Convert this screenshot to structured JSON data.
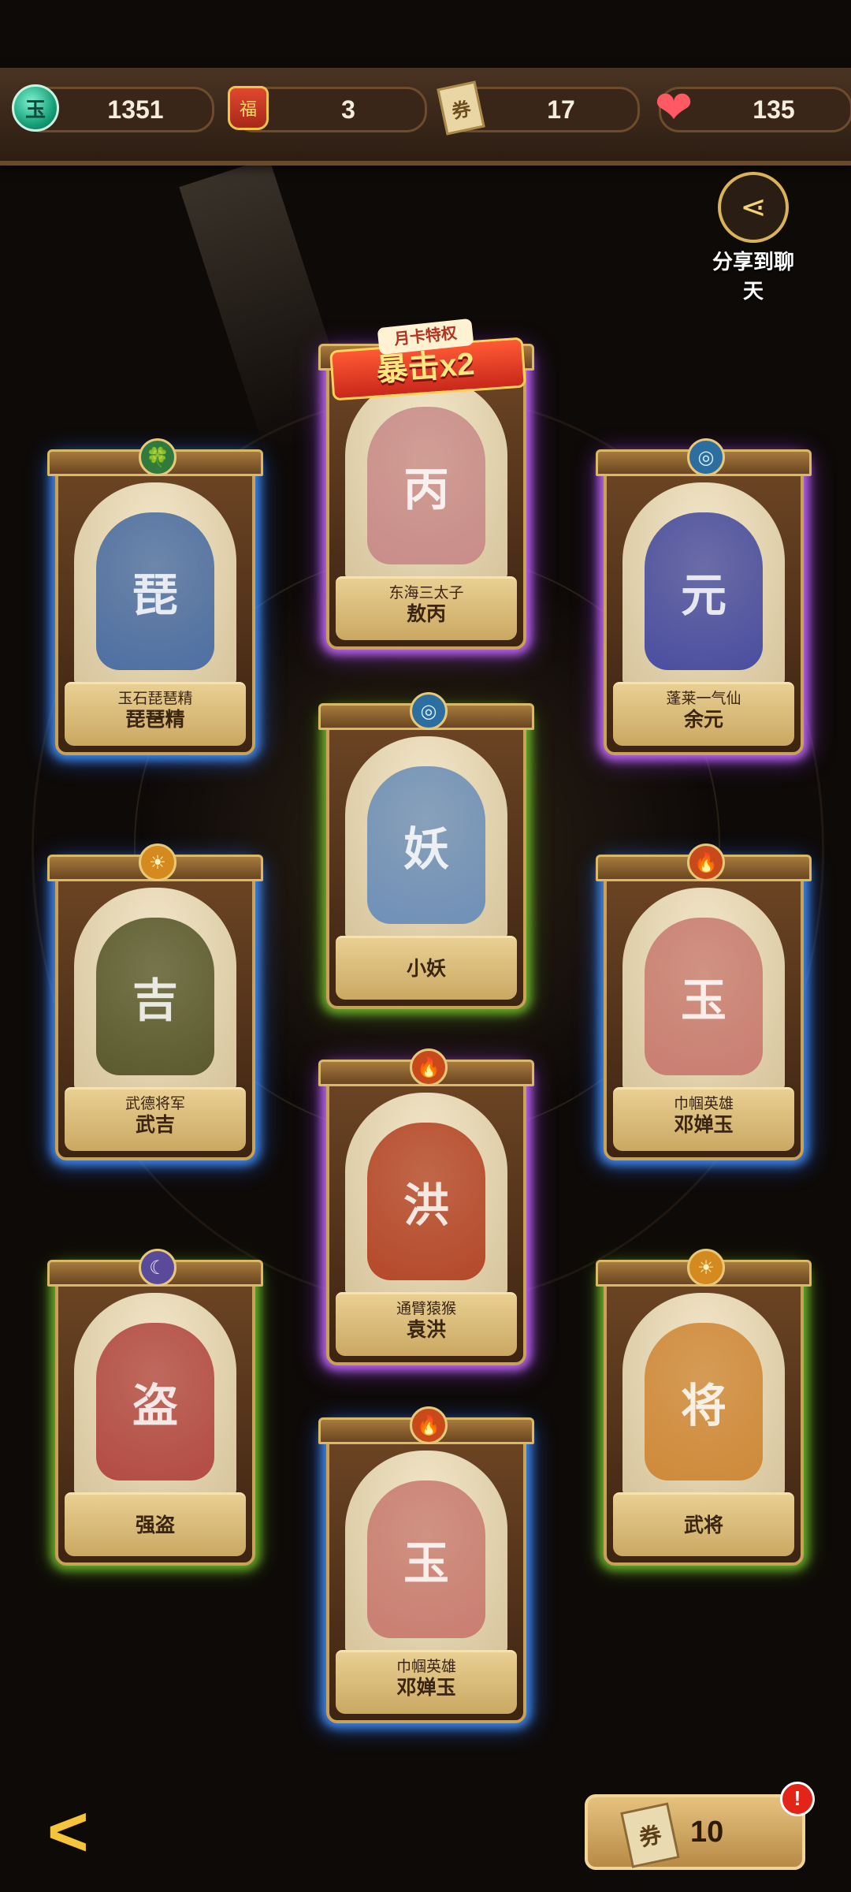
{
  "resources": [
    {
      "icon": "jade-coin-icon",
      "glyph": "玉",
      "value": "1351"
    },
    {
      "icon": "red-bag-icon",
      "glyph": "福",
      "value": "3"
    },
    {
      "icon": "ticket-icon",
      "glyph": "券",
      "value": "17"
    },
    {
      "icon": "heart-icon",
      "glyph": "❤",
      "value": "135"
    }
  ],
  "share": {
    "icon": "share-icon",
    "glyph": "⋖",
    "label": "分享到聊天"
  },
  "badge": {
    "top": "月卡特权",
    "main": "暴击x2"
  },
  "cards": [
    {
      "sub": "东海三太子",
      "name": "敖丙",
      "glow": "purple",
      "glyph": "丙",
      "color": "#c98d8a"
    },
    {
      "sub": "玉石琵琶精",
      "name": "琵琶精",
      "glow": "blue",
      "emblem": "🍀",
      "emblem_class": "e-green",
      "glyph": "琵",
      "color": "#4d6fa3"
    },
    {
      "sub": "蓬莱一气仙",
      "name": "余元",
      "glow": "purple",
      "emblem": "◎",
      "emblem_class": "e-water",
      "glyph": "元",
      "color": "#4a4ea0"
    },
    {
      "sub": "",
      "name": "小妖",
      "glow": "green",
      "emblem": "◎",
      "emblem_class": "e-water",
      "glyph": "妖",
      "color": "#6f90b8"
    },
    {
      "sub": "武德将军",
      "name": "武吉",
      "glow": "blue",
      "emblem": "☀",
      "emblem_class": "e-sun",
      "glyph": "吉",
      "color": "#5a5a2e"
    },
    {
      "sub": "巾帼英雄",
      "name": "邓婵玉",
      "glow": "blue",
      "emblem": "🔥",
      "emblem_class": "e-fire",
      "glyph": "玉",
      "color": "#c97e72"
    },
    {
      "sub": "通臂猿猴",
      "name": "袁洪",
      "glow": "purple",
      "emblem": "🔥",
      "emblem_class": "e-fire",
      "glyph": "洪",
      "color": "#b5482a"
    },
    {
      "sub": "",
      "name": "强盗",
      "glow": "green",
      "emblem": "☾",
      "emblem_class": "e-moon",
      "glyph": "盗",
      "color": "#b34b44"
    },
    {
      "sub": "",
      "name": "武将",
      "glow": "green",
      "emblem": "☀",
      "emblem_class": "e-sun",
      "glyph": "将",
      "color": "#cf8a3a"
    },
    {
      "sub": "巾帼英雄",
      "name": "邓婵玉",
      "glow": "blue",
      "emblem": "🔥",
      "emblem_class": "e-fire",
      "glyph": "玉",
      "color": "#c97e72"
    }
  ],
  "footer": {
    "back_icon": "back-arrow-icon",
    "back_glyph": "<",
    "ticket_glyph": "券",
    "ticket_count": "10",
    "alert": "!"
  }
}
